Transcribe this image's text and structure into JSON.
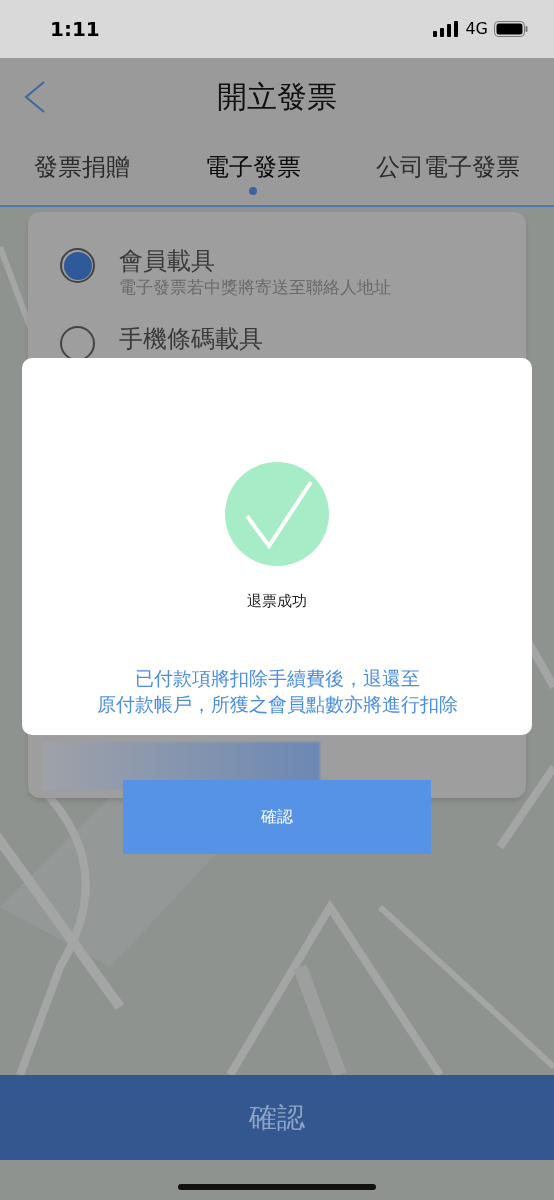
{
  "status_bar": {
    "time": "1:11",
    "network": "4G"
  },
  "header": {
    "title": "開立發票"
  },
  "tabs": [
    {
      "label": "發票捐贈",
      "selected": false
    },
    {
      "label": "電子發票",
      "selected": true
    },
    {
      "label": "公司電子發票",
      "selected": false
    }
  ],
  "carrier_options": [
    {
      "label": "會員載具",
      "note": "電子發票若中獎將寄送至聯絡人地址",
      "selected": true
    },
    {
      "label": "手機條碼載具",
      "selected": false
    }
  ],
  "dialog": {
    "status": "退票成功",
    "message_lines": [
      "已付款項將扣除手續費後，退還至",
      "原付款帳戶，所獲之會員點數亦將進行扣除"
    ],
    "button": "確認"
  },
  "footer_button": "確認"
}
